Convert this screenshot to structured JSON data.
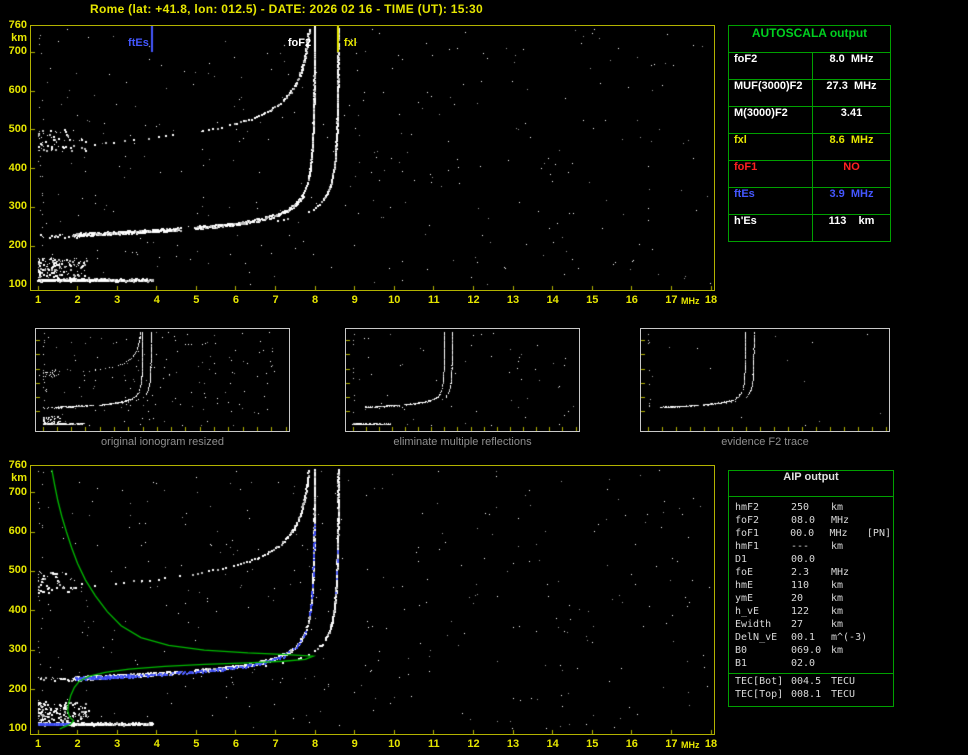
{
  "title": "Rome (lat: +41.8, lon: 012.5) - DATE: 2026 02 16 - TIME (UT): 15:30",
  "colors": {
    "yellow": "#e6e600",
    "plot_border": "#b2b200",
    "table_green": "#00a000",
    "header_green": "#00d020",
    "blue": "#4457ff",
    "red": "#ff2020",
    "white": "#ffffff",
    "caption_gray": "#8f8f8f",
    "profile_green": "#00bb00"
  },
  "autoscala_table": {
    "header": "AUTOSCALA output",
    "rows": [
      {
        "label": "foF2",
        "value": "8.0  MHz",
        "color": "#ffffff"
      },
      {
        "label": "MUF(3000)F2",
        "value": "27.3  MHz",
        "color": "#ffffff"
      },
      {
        "label": "M(3000)F2",
        "value": "3.41",
        "color": "#ffffff"
      },
      {
        "label": "fxl",
        "value": "8.6  MHz",
        "color": "#e6e600"
      },
      {
        "label": "foF1",
        "value": "NO",
        "color": "#ff2020"
      },
      {
        "label": "ftEs",
        "value": "3.9  MHz",
        "color": "#4457ff"
      },
      {
        "label": "h'Es",
        "value": "113    km",
        "color": "#ffffff"
      }
    ]
  },
  "thumbnails": [
    {
      "caption": "original ionogram resized",
      "show_multiples": true,
      "show_es": true,
      "show_spread": true,
      "show_clusters": true,
      "noise": 150
    },
    {
      "caption": "eliminate multiple reflections",
      "show_multiples": false,
      "show_es": true,
      "show_spread": false,
      "show_clusters": false,
      "noise": 55
    },
    {
      "caption": "evidence F2 trace",
      "show_multiples": false,
      "show_es": false,
      "show_spread": false,
      "show_clusters": false,
      "noise": 14
    }
  ],
  "aip_table": {
    "header": "AIP output",
    "rows": [
      {
        "label": "hmF2",
        "value": "250",
        "unit": "km",
        "extra": ""
      },
      {
        "label": "foF2",
        "value": "08.0",
        "unit": "MHz",
        "extra": ""
      },
      {
        "label": "foF1",
        "value": "00.0",
        "unit": "MHz",
        "extra": "[PN]"
      },
      {
        "label": "hmF1",
        "value": "---",
        "unit": "km",
        "extra": ""
      },
      {
        "label": "D1",
        "value": "00.0",
        "unit": "",
        "extra": ""
      },
      {
        "label": "foE",
        "value": "2.3",
        "unit": "MHz",
        "extra": ""
      },
      {
        "label": "hmE",
        "value": "110",
        "unit": "km",
        "extra": ""
      },
      {
        "label": "ymE",
        "value": "20",
        "unit": "km",
        "extra": ""
      },
      {
        "label": "h_vE",
        "value": "122",
        "unit": "km",
        "extra": ""
      },
      {
        "label": "Ewidth",
        "value": "27",
        "unit": "km",
        "extra": ""
      },
      {
        "label": "DelN_vE",
        "value": "00.1",
        "unit": "m^(-3)",
        "extra": ""
      },
      {
        "label": "B0",
        "value": "069.0",
        "unit": "km",
        "extra": ""
      },
      {
        "label": "B1",
        "value": "02.0",
        "unit": "",
        "extra": ""
      },
      {
        "label": "TEC[Bot]",
        "value": "004.5",
        "unit": "TECU",
        "extra": "",
        "sep_before": true
      },
      {
        "label": "TEC[Top]",
        "value": "008.1",
        "unit": "TECU",
        "extra": ""
      }
    ]
  },
  "chart_data": [
    {
      "id": "ionogram-top",
      "type": "scatter",
      "title": "",
      "xlabel": "MHz",
      "ylabel": "km",
      "xlim": [
        1,
        18
      ],
      "ylim": [
        100,
        760
      ],
      "x_ticks": [
        1,
        2,
        3,
        4,
        5,
        6,
        7,
        8,
        9,
        10,
        11,
        12,
        13,
        14,
        15,
        16,
        17,
        18
      ],
      "y_ticks": [
        700,
        600,
        500,
        400,
        300,
        200,
        100
      ],
      "y_max_label": "760",
      "grid": false,
      "legend": "none",
      "markers": [
        {
          "label": "ftEs",
          "freq": 3.9,
          "color": "#4457ff",
          "label_side": "left"
        },
        {
          "label": "foF2",
          "freq": 8.0,
          "color": "#ffffff",
          "label_side": "left"
        },
        {
          "label": "fxl",
          "freq": 8.6,
          "color": "#e6e600",
          "label_side": "right"
        }
      ],
      "gaps": [
        [
          4.6,
          4.95
        ]
      ],
      "layers": {
        "f2_o_trace": {
          "h_base_km": 222,
          "amp": 32,
          "fc_mhz": 8.0,
          "f_start_mhz": 1.9
        },
        "f2_x_trace": {
          "fx_mhz": 8.6,
          "o_x_shift_mhz": 0.6
        },
        "f2_multiple": {
          "hop_factor": 2
        },
        "es_trace": {
          "height_km": 113,
          "f_start_mhz": 1.0,
          "f_end_mhz": 3.9
        },
        "es_multiple": {
          "height_km": 226,
          "f_end_mhz": 2.4
        },
        "es_spread": {
          "f_range": [
            1.0,
            2.3
          ],
          "h_range": [
            118,
            170
          ]
        },
        "left_cluster": {
          "f_range": [
            1.0,
            2.2
          ],
          "h_range": [
            445,
            500
          ]
        }
      }
    },
    {
      "id": "ionogram-bottom",
      "type": "scatter",
      "title": "",
      "xlabel": "MHz",
      "ylabel": "km",
      "xlim": [
        1,
        18
      ],
      "ylim": [
        100,
        760
      ],
      "x_ticks": [
        1,
        2,
        3,
        4,
        5,
        6,
        7,
        8,
        9,
        10,
        11,
        12,
        13,
        14,
        15,
        16,
        17,
        18
      ],
      "y_ticks": [
        700,
        600,
        500,
        400,
        300,
        200,
        100
      ],
      "y_max_label": "760",
      "grid": false,
      "legend": "none",
      "gaps": [
        [
          4.6,
          4.95
        ]
      ],
      "restored_trace_color": "#3b4bf0",
      "layers": {
        "f2_o_trace": {
          "h_base_km": 222,
          "amp": 32,
          "fc_mhz": 8.0,
          "f_start_mhz": 1.9
        },
        "f2_x_trace": {
          "fx_mhz": 8.6,
          "o_x_shift_mhz": 0.6
        },
        "f2_multiple": {
          "hop_factor": 2
        },
        "es_trace": {
          "height_km": 113,
          "f_start_mhz": 1.0,
          "f_end_mhz": 3.9
        },
        "es_multiple": {
          "height_km": 226,
          "f_end_mhz": 2.4
        },
        "es_spread": {
          "f_range": [
            1.0,
            2.3
          ],
          "h_range": [
            118,
            170
          ]
        },
        "left_cluster": {
          "f_range": [
            1.0,
            2.2
          ],
          "h_range": [
            445,
            500
          ]
        }
      },
      "profile": {
        "color": "#00bb00",
        "points": [
          [
            1.35,
            758
          ],
          [
            1.42,
            720
          ],
          [
            1.5,
            680
          ],
          [
            1.6,
            640
          ],
          [
            1.72,
            600
          ],
          [
            1.85,
            560
          ],
          [
            2.0,
            520
          ],
          [
            2.2,
            478
          ],
          [
            2.45,
            438
          ],
          [
            2.75,
            398
          ],
          [
            3.1,
            362
          ],
          [
            3.6,
            332
          ],
          [
            4.3,
            312
          ],
          [
            5.2,
            300
          ],
          [
            6.3,
            293
          ],
          [
            7.3,
            289
          ],
          [
            7.95,
            285
          ],
          [
            7.75,
            277
          ],
          [
            7.2,
            272
          ],
          [
            6.3,
            268
          ],
          [
            5.2,
            264
          ],
          [
            4.2,
            259
          ],
          [
            3.3,
            252
          ],
          [
            2.7,
            244
          ],
          [
            2.3,
            234
          ],
          [
            2.05,
            222
          ],
          [
            1.92,
            206
          ],
          [
            1.83,
            186
          ],
          [
            1.77,
            164
          ],
          [
            1.75,
            146
          ],
          [
            1.8,
            130
          ],
          [
            1.9,
            121
          ],
          [
            1.82,
            112
          ],
          [
            1.65,
            105
          ],
          [
            1.55,
            100
          ]
        ]
      }
    }
  ]
}
